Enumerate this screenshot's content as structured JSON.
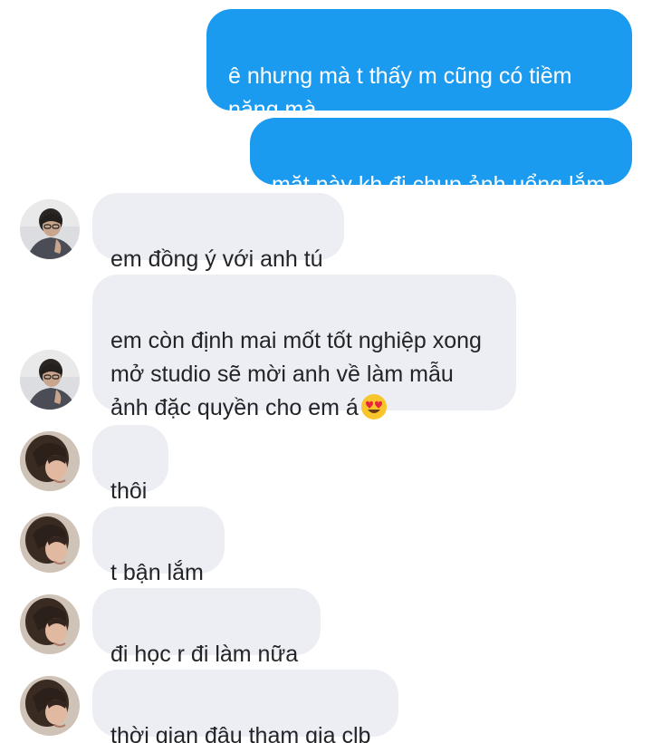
{
  "messages": [
    {
      "direction": "outgoing",
      "text": "ê nhưng mà t thấy m cũng có tiềm\nnăng mà"
    },
    {
      "direction": "outgoing",
      "text": "mặt này kh đi chụp ảnh uổng lắm"
    },
    {
      "direction": "incoming",
      "sender": "user-a",
      "text": "em đồng ý với anh tú"
    },
    {
      "direction": "incoming",
      "sender": "user-a",
      "text": "em còn định mai mốt tốt nghiệp xong\nmở studio sẽ mời anh về làm mẫu\nảnh đặc quyền cho em á",
      "emoji": "heart-eyes-emoji"
    },
    {
      "direction": "incoming",
      "sender": "user-b",
      "text": "thôi"
    },
    {
      "direction": "incoming",
      "sender": "user-b",
      "text": "t bận lắm"
    },
    {
      "direction": "incoming",
      "sender": "user-b",
      "text": "đi học r đi làm nữa"
    },
    {
      "direction": "incoming",
      "sender": "user-b",
      "text": "thời gian đâu tham gia clb"
    }
  ],
  "colors": {
    "outgoing_bubble": "#1b9bf0",
    "incoming_bubble": "#eceef3",
    "outgoing_text": "#ffffff",
    "incoming_text": "#222428"
  }
}
